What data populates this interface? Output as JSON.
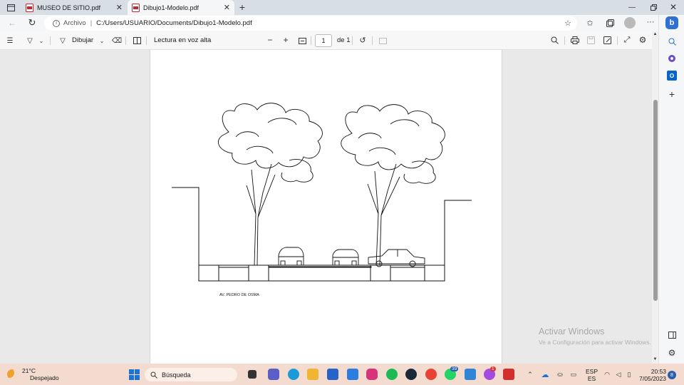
{
  "browser": {
    "tabs": [
      {
        "title": "MUSEO DE SITIO.pdf",
        "active": false
      },
      {
        "title": "Dibujo1-Modelo.pdf",
        "active": true
      }
    ],
    "address": {
      "origin_label": "Archivo",
      "url": "C:/Users/USUARIO/Documents/Dibujo1-Modelo.pdf"
    }
  },
  "pdf_toolbar": {
    "draw_label": "Dibujar",
    "read_aloud_label": "Lectura en voz alta",
    "page_current": "1",
    "page_total_label": "de 1"
  },
  "drawing": {
    "caption": "AV. PEDRO DE OSMA"
  },
  "watermark": {
    "title": "Activar Windows",
    "subtitle": "Ve a Configuración para activar Windows."
  },
  "taskbar": {
    "temperature": "21°C",
    "condition": "Despejado",
    "search_placeholder": "Búsqueda",
    "language": "ESP",
    "language_sub": "ES",
    "time": "20:53",
    "date": "7/05/2023",
    "notification_count": "8",
    "whatsapp_badge": "39",
    "messenger_badge": "1"
  }
}
